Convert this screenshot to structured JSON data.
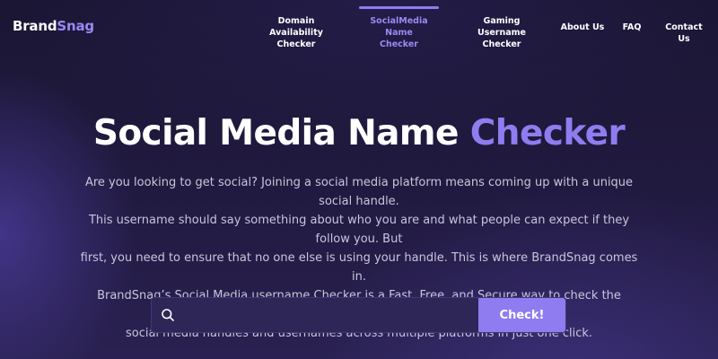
{
  "brand": {
    "name_part1": "Brand",
    "name_part2": "Snag"
  },
  "nav": {
    "items": [
      {
        "line1": "Domain Availability",
        "line2": "Checker"
      },
      {
        "line1": "SocialMedia Name",
        "line2": "Checker"
      },
      {
        "line1": "Gaming Username",
        "line2": "Checker"
      },
      {
        "line1": "About Us",
        "line2": ""
      },
      {
        "line1": "FAQ",
        "line2": ""
      },
      {
        "line1": "Contact Us",
        "line2": ""
      }
    ],
    "active_index": 1
  },
  "hero": {
    "title_main": "Social Media Name",
    "title_accent": "Checker",
    "description_lines": [
      "Are you looking to get social? Joining a social media platform means coming up with a unique social handle.",
      "This username should say something about who you are and what people can expect if they follow you. But",
      "first, you need to ensure that no one else is using your handle. This is where BrandSnag comes in.",
      "BrandSnag’s Social Media username Checker is a Fast, Free, and Secure way to check the availability of",
      "social media handles and usernames across multiple platforms in just one click."
    ]
  },
  "search": {
    "value": "",
    "placeholder": "",
    "button_label": "Check!",
    "icon": "search-icon"
  },
  "colors": {
    "background": "#1d1838",
    "accent": "#8f7cf0",
    "text": "#ffffff",
    "muted_text": "#c9c5dc",
    "input_bg": "#2d2657"
  }
}
